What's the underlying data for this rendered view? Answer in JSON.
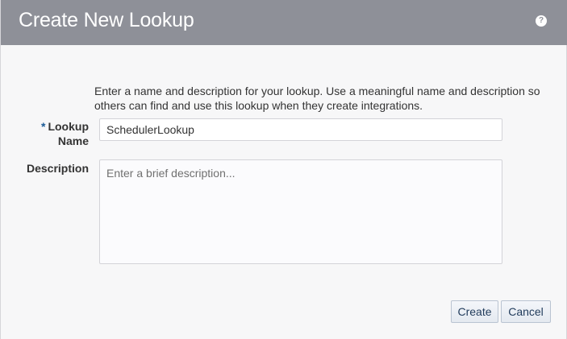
{
  "dialog": {
    "title": "Create New Lookup",
    "help_icon": "help-icon",
    "instructions": "Enter a name and description for your lookup. Use a meaningful name and description so others can find and use this lookup when they create integrations."
  },
  "form": {
    "lookup_name": {
      "required_marker": "*",
      "label": "Lookup Name",
      "value": "SchedulerLookup"
    },
    "description": {
      "label": "Description",
      "placeholder": "Enter a brief description...",
      "value": ""
    }
  },
  "buttons": {
    "create_label": "Create",
    "cancel_label": "Cancel"
  },
  "colors": {
    "header_bg": "#8e9098",
    "required_marker": "#1a5a96",
    "button_text": "#1f3a5a"
  }
}
